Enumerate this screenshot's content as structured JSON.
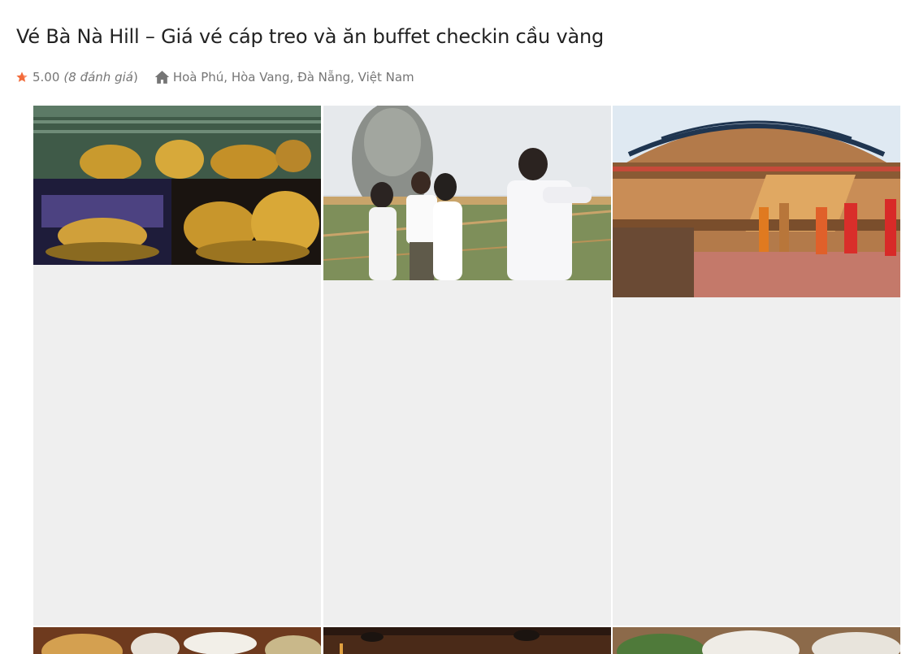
{
  "page": {
    "title": "Vé Bà Nà Hill – Giá vé cáp treo và ăn buffet checkin cầu vàng"
  },
  "meta": {
    "rating_value": "5.00",
    "rating_count": "(8 đánh giá",
    "rating_close": ")",
    "location": "Hoà Phú, Hòa Vang, Đà Nẵng, Việt Nam",
    "star_icon": "star-icon",
    "location_icon": "home-icon",
    "accent_color": "#f26b3a"
  },
  "gallery": {
    "photos": [
      {
        "subject": "golden horse statues"
      },
      {
        "subject": "couple on golden bridge"
      },
      {
        "subject": "indoor stage performance"
      },
      {
        "subject": "buffet food"
      },
      {
        "subject": "restaurant interior"
      },
      {
        "subject": "buffet dishes"
      }
    ]
  }
}
